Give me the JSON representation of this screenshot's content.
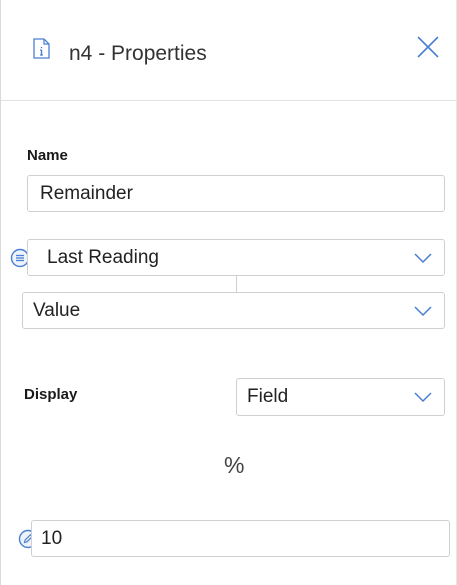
{
  "header": {
    "title": "n4 - Properties",
    "doc_icon": "document-info-icon",
    "close_icon": "close-icon"
  },
  "name_section": {
    "label": "Name",
    "value": "Remainder"
  },
  "reading_select": {
    "value": "Last Reading",
    "icon": "list-circle-icon"
  },
  "value_select": {
    "value": "Value"
  },
  "display_section": {
    "label": "Display",
    "select_value": "Field"
  },
  "percent_symbol": "%",
  "number_input": {
    "value": "10",
    "icon": "pencil-circle-icon"
  },
  "colors": {
    "accent": "#4a7fd4",
    "border": "#cfcfcf"
  }
}
